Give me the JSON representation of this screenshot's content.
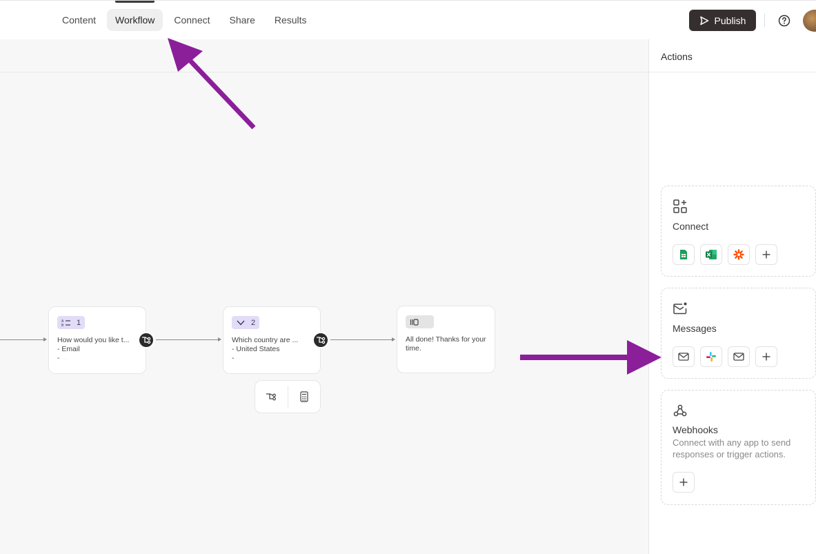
{
  "nav": {
    "tabs": [
      {
        "label": "Content"
      },
      {
        "label": "Workflow",
        "active": true
      },
      {
        "label": "Connect"
      },
      {
        "label": "Share"
      },
      {
        "label": "Results"
      }
    ],
    "publish_label": "Publish"
  },
  "canvas": {
    "nodes": [
      {
        "number": "1",
        "icon": "list-icon",
        "title": "How would you like t...",
        "options": [
          "- Email",
          "- ..."
        ]
      },
      {
        "number": "2",
        "icon": "chevron-down-icon",
        "title": "Which country are ...",
        "options": [
          "- United States",
          "- ..."
        ]
      },
      {
        "icon": "ending-icon",
        "title": "All done! Thanks for your time."
      }
    ]
  },
  "panel": {
    "title": "Actions",
    "cards": {
      "connect": {
        "title": "Connect",
        "icon": "apps-add-icon",
        "chips": [
          "google-sheets-icon",
          "excel-icon",
          "zapier-icon",
          "plus-icon"
        ]
      },
      "messages": {
        "title": "Messages",
        "icon": "mail-notification-icon",
        "chips": [
          "mail-icon",
          "slack-icon",
          "mail-icon",
          "plus-icon"
        ]
      },
      "webhooks": {
        "title": "Webhooks",
        "icon": "webhook-icon",
        "description": "Connect with any app to send responses or trigger actions.",
        "chips": [
          "plus-icon"
        ]
      }
    }
  },
  "colors": {
    "accent_dark": "#35302f",
    "badge_purple": "#e2dcf7",
    "annotation_arrow": "#8b1f9a"
  }
}
